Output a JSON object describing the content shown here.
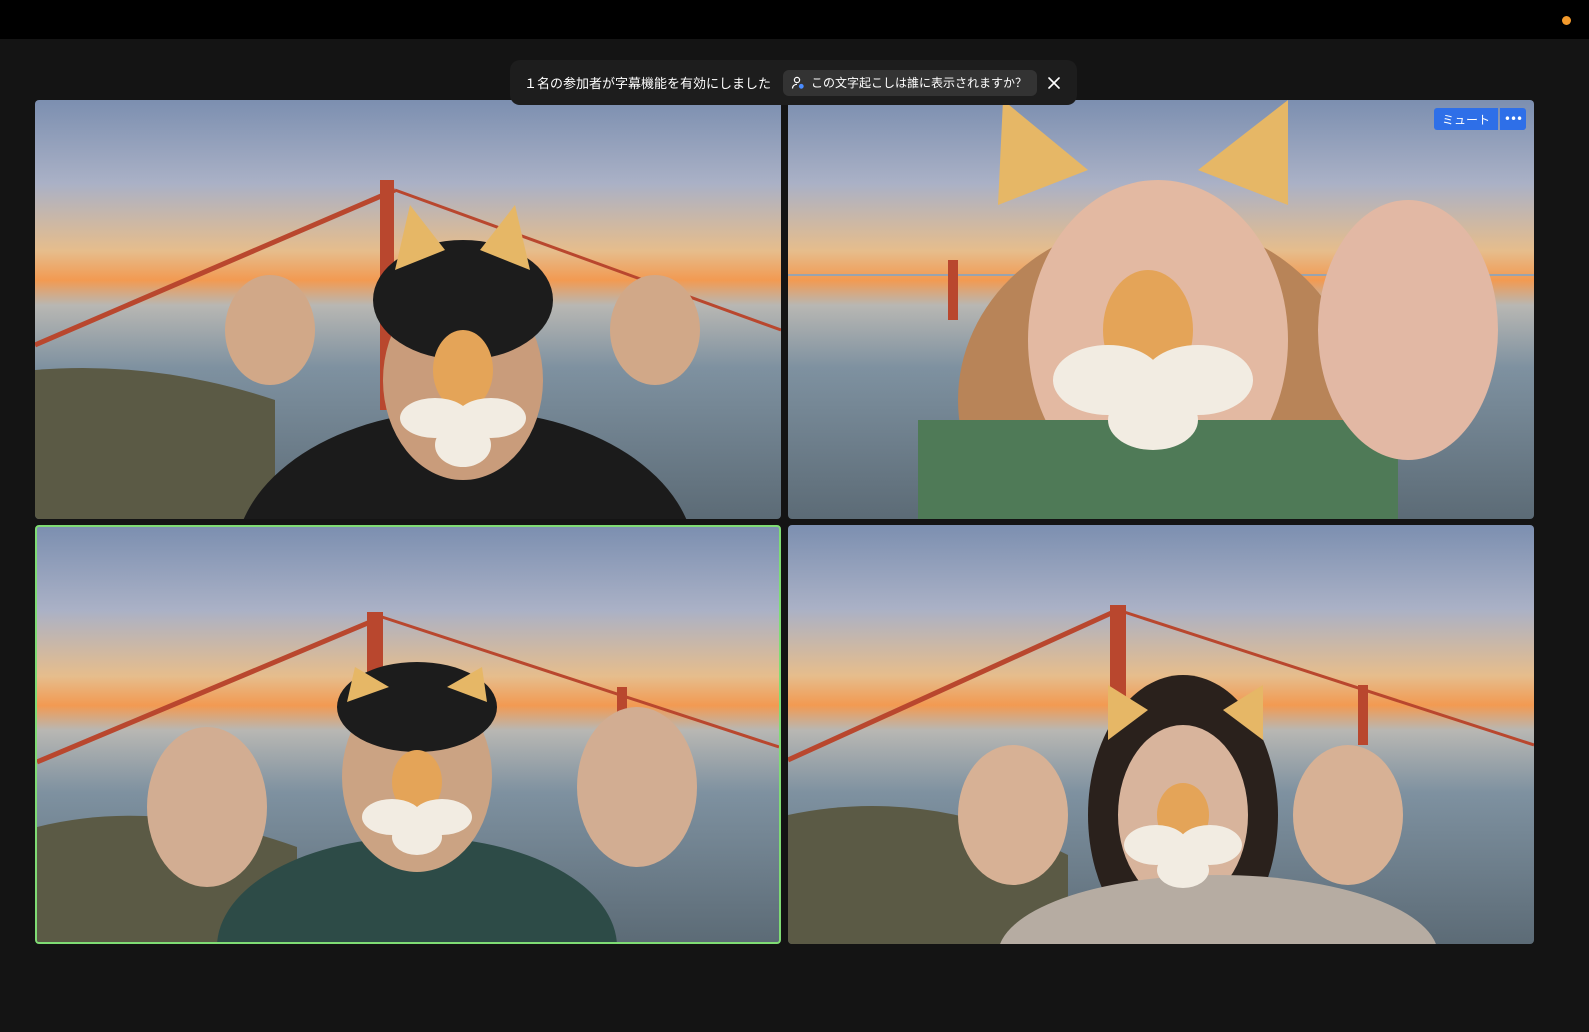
{
  "colors": {
    "background": "#141414",
    "topbar": "#000000",
    "recording_dot": "#f39a2c",
    "active_speaker_border": "#7fdc74",
    "button_blue": "#2e6fe8"
  },
  "caption_banner": {
    "message": "１名の参加者が字幕機能を有効にしました",
    "question_button": "この文字起こしは誰に表示されますか？",
    "close_icon": "close-icon"
  },
  "tile_controls": {
    "mute_label": "ミュート",
    "more_label": "•••"
  },
  "participants": [
    {
      "position": "top-left",
      "filter": "lion-face",
      "active": false
    },
    {
      "position": "top-right",
      "filter": "lion-face",
      "active": false
    },
    {
      "position": "bottom-left",
      "filter": "lion-face",
      "active": true
    },
    {
      "position": "bottom-right",
      "filter": "lion-face",
      "active": false
    }
  ]
}
